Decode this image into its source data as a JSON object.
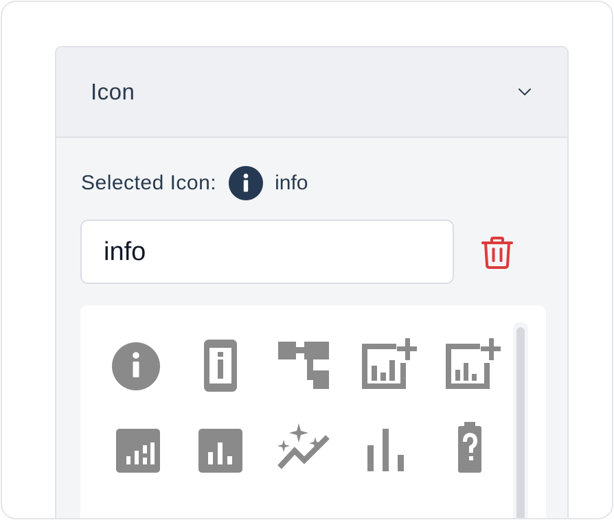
{
  "section": {
    "title": "Icon",
    "collapse_icon": "chevron-down-icon"
  },
  "selected": {
    "label": "Selected Icon:",
    "icon": "info-circle-icon",
    "name": "info"
  },
  "search": {
    "value": "info"
  },
  "delete_icon": "trash-icon",
  "icon_grid": {
    "icons": [
      "info",
      "mobile-info",
      "account-tree",
      "add-chart",
      "add-chart-outline",
      "analytics",
      "bar-chart-box",
      "auto-graph",
      "bar-chart",
      "battery-unknown"
    ]
  },
  "colors": {
    "text": "#2a3a4e",
    "icon_gray": "#8a8a8a",
    "danger": "#dc3b3b",
    "selected_icon_bg": "#253a52"
  }
}
